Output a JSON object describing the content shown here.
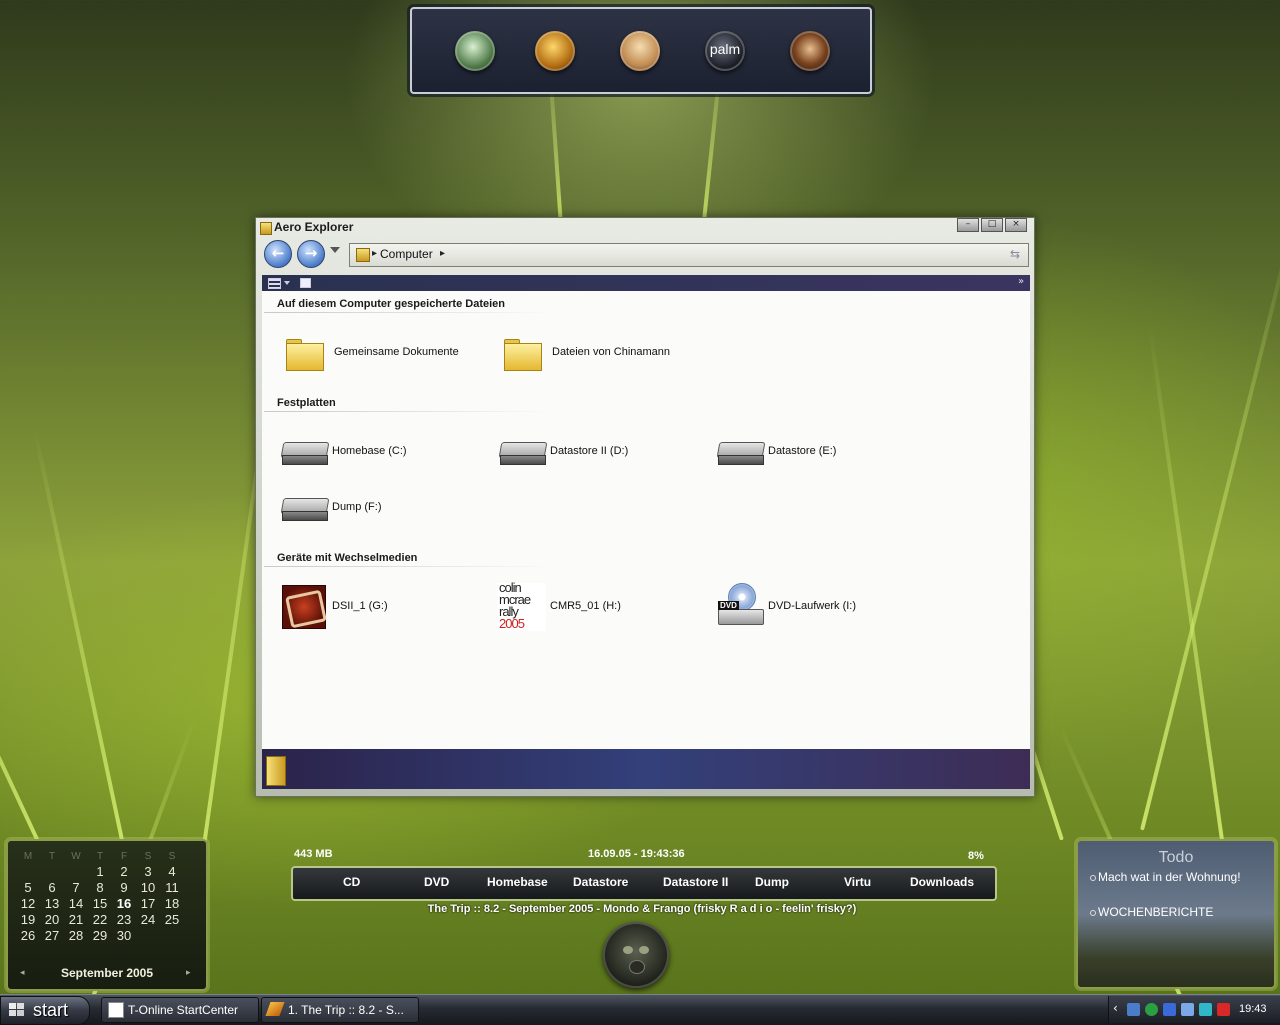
{
  "dock": {
    "icons": [
      "green-orb-icon",
      "earth-orb-icon",
      "face-orb-icon",
      "palm-orb-icon",
      "eye-orb-icon"
    ],
    "palm_label": "palm"
  },
  "window": {
    "title": "Aero Explorer",
    "address": "Computer",
    "groups": [
      {
        "title": "Auf diesem Computer gespeicherte Dateien",
        "items": [
          {
            "label": "Gemeinsame Dokumente",
            "icon": "folder-icon"
          },
          {
            "label": "Dateien von Chinamann",
            "icon": "folder-icon"
          }
        ]
      },
      {
        "title": "Festplatten",
        "items": [
          {
            "label": "Homebase (C:)",
            "icon": "hard-drive-icon"
          },
          {
            "label": "Datastore II (D:)",
            "icon": "hard-drive-icon"
          },
          {
            "label": "Datastore (E:)",
            "icon": "hard-drive-icon"
          },
          {
            "label": "Dump (F:)",
            "icon": "hard-drive-icon"
          }
        ]
      },
      {
        "title": "Geräte mit Wechselmedien",
        "items": [
          {
            "label": "DSII_1 (G:)",
            "icon": "ds-game-icon"
          },
          {
            "label": "CMR5_01 (H:)",
            "icon": "colin-mcrae-icon"
          },
          {
            "label": "DVD-Laufwerk (I:)",
            "icon": "dvd-drive-icon"
          }
        ]
      }
    ],
    "cmr_logo": [
      "colin",
      "mcrae",
      "rally",
      "2005"
    ],
    "dvd_label": "DVD"
  },
  "calendar": {
    "weekdays": [
      "M",
      "T",
      "W",
      "T",
      "F",
      "S",
      "S"
    ],
    "weeks": [
      [
        "",
        "",
        "",
        "1",
        "2",
        "3",
        "4"
      ],
      [
        "5",
        "6",
        "7",
        "8",
        "9",
        "10",
        "11"
      ],
      [
        "12",
        "13",
        "14",
        "15",
        "16",
        "17",
        "18"
      ],
      [
        "19",
        "20",
        "21",
        "22",
        "23",
        "24",
        "25"
      ],
      [
        "26",
        "27",
        "28",
        "29",
        "30",
        "",
        ""
      ]
    ],
    "today": "16",
    "month": "September 2005"
  },
  "drivebar": {
    "memory": "443 MB",
    "datetime": "16.09.05 - 19:43:36",
    "cpu": "8%",
    "drives": [
      "CD",
      "DVD",
      "Homebase",
      "Datastore",
      "Datastore II",
      "Dump",
      "Virtu",
      "Downloads"
    ],
    "now_playing": "The Trip :: 8.2 - September 2005 - Mondo & Frango (frisky R a d i o - feelin' frisky?)"
  },
  "todo": {
    "title": "Todo",
    "items": [
      "Mach wat in der Wohnung!",
      "WOCHENBERICHTE"
    ]
  },
  "taskbar": {
    "start_label": "start",
    "tasks": [
      "T-Online StartCenter",
      "1. The Trip :: 8.2 - S..."
    ],
    "clock": "19:43"
  }
}
